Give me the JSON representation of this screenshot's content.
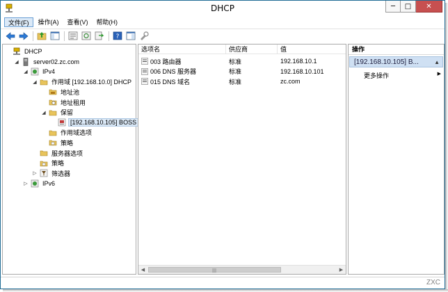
{
  "window": {
    "title": "DHCP",
    "close_glyph": "✕",
    "minimize_glyph": "─",
    "maximize_glyph": "□"
  },
  "menu": [
    {
      "label": "文件(F)",
      "active": true
    },
    {
      "label": "操作(A)",
      "active": false
    },
    {
      "label": "查看(V)",
      "active": false
    },
    {
      "label": "帮助(H)",
      "active": false
    }
  ],
  "toolbar": {
    "icons": [
      "back-arrow-icon",
      "forward-arrow-icon",
      "up-folder-icon",
      "show-hide-tree-icon",
      "properties-icon",
      "refresh-icon",
      "export-list-icon",
      "help-icon",
      "show-action-pane-icon",
      "action-icon"
    ]
  },
  "tree": [
    {
      "label": "DHCP",
      "icon": "dhcp-icon",
      "depth": 0,
      "expander": ""
    },
    {
      "label": "server02.zc.com",
      "icon": "server-icon",
      "depth": 1,
      "expander": "◢"
    },
    {
      "label": "IPv4",
      "icon": "ipv4-icon",
      "depth": 2,
      "expander": "◢"
    },
    {
      "label": "作用域 [192.168.10.0] DHCP",
      "icon": "folder-icon",
      "depth": 3,
      "expander": "◢"
    },
    {
      "label": "地址池",
      "icon": "address-pool-icon",
      "depth": 4,
      "expander": ""
    },
    {
      "label": "地址租用",
      "icon": "address-lease-icon",
      "depth": 4,
      "expander": ""
    },
    {
      "label": "保留",
      "icon": "folder-icon",
      "depth": 4,
      "expander": "◢"
    },
    {
      "label": "[192.168.10.105] BOSS",
      "icon": "reservation-icon",
      "depth": 5,
      "expander": "",
      "selected": true
    },
    {
      "label": "作用域选项",
      "icon": "folder-icon",
      "depth": 4,
      "expander": ""
    },
    {
      "label": "策略",
      "icon": "policy-icon",
      "depth": 4,
      "expander": ""
    },
    {
      "label": "服务器选项",
      "icon": "folder-icon",
      "depth": 3,
      "expander": ""
    },
    {
      "label": "策略",
      "icon": "policy-icon",
      "depth": 3,
      "expander": ""
    },
    {
      "label": "筛选器",
      "icon": "filter-icon",
      "depth": 3,
      "expander": "▷"
    },
    {
      "label": "IPv6",
      "icon": "ipv6-icon",
      "depth": 2,
      "expander": "▷"
    }
  ],
  "list": {
    "columns": [
      "选项名",
      "供应商",
      "值"
    ],
    "rows": [
      {
        "name": "003 路由器",
        "vendor": "标准",
        "value": "192.168.10.1"
      },
      {
        "name": "006 DNS 服务器",
        "vendor": "标准",
        "value": "192.168.10.101"
      },
      {
        "name": "015 DNS 域名",
        "vendor": "标准",
        "value": "zc.com"
      }
    ],
    "scroll_left": "◀",
    "scroll_right": "▶",
    "scroll_grip": "|||"
  },
  "actions": {
    "title": "操作",
    "section": "[192.168.10.105] B...",
    "section_toggle": "▲",
    "items": [
      {
        "label": "更多操作",
        "arrow": "▶"
      }
    ]
  },
  "watermark": "ZXC",
  "colors": {
    "selection": "#dbe9f7",
    "action_header": "#cfe0f3",
    "close_button": "#c75050"
  }
}
